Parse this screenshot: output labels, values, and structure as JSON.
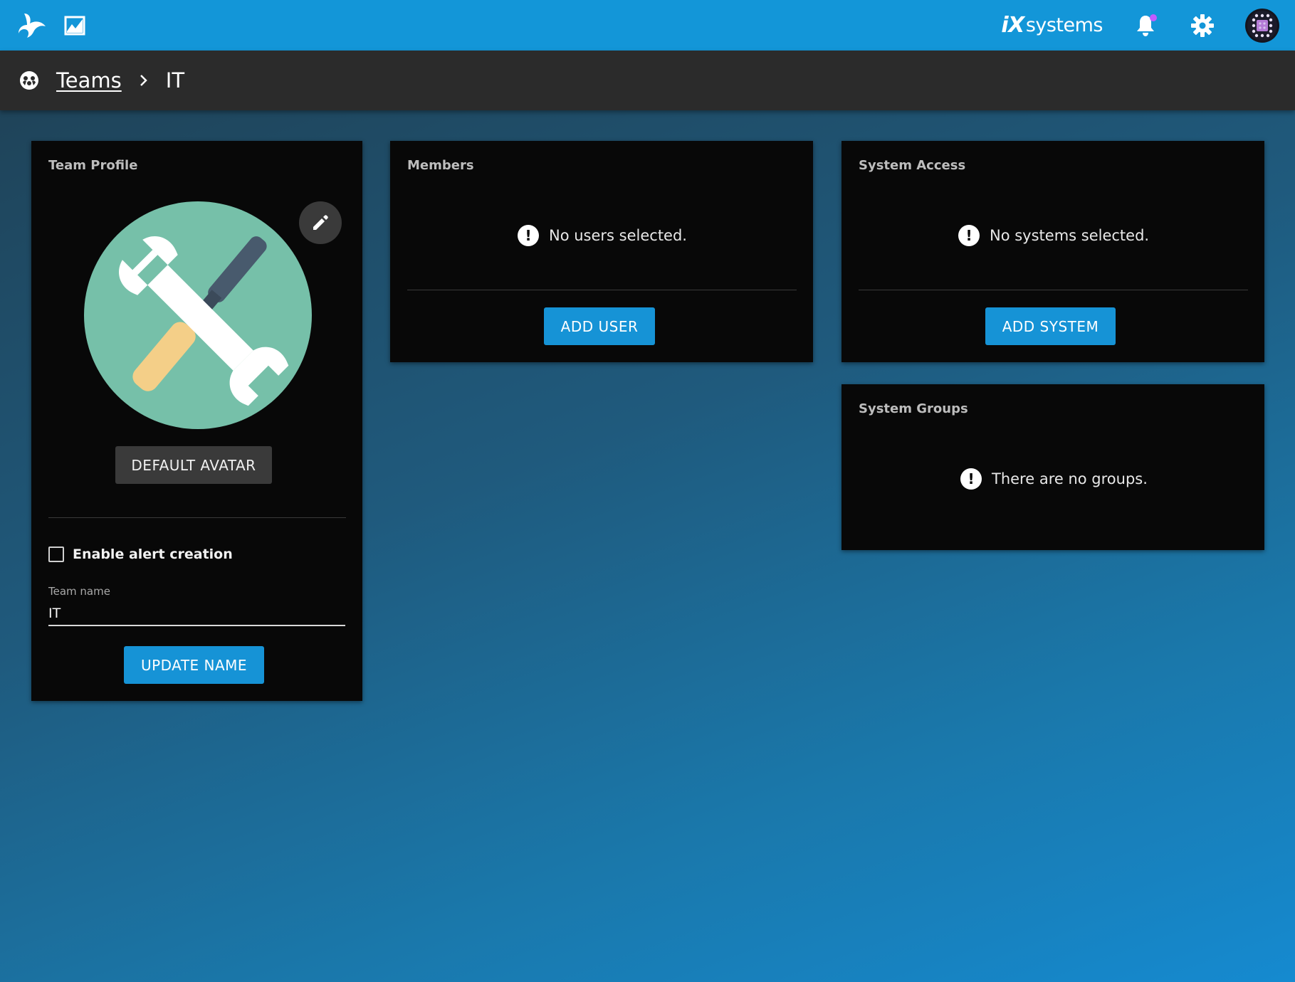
{
  "topbar": {
    "brand_ix": "iX",
    "brand_rest": "systems",
    "icons": [
      "app-logo-icon",
      "chart-icon",
      "bell-icon",
      "gear-icon",
      "user-avatar"
    ],
    "accent_color": "#1396d8",
    "notification_dot_color": "#c25cff"
  },
  "breadcrumb": {
    "icon": "teams-icon",
    "parent": "Teams",
    "current": "IT"
  },
  "team_profile": {
    "title": "Team Profile",
    "default_avatar_label": "DEFAULT AVATAR",
    "enable_alert_label": "Enable alert creation",
    "enable_alert_checked": false,
    "team_name_label": "Team name",
    "team_name_value": "IT",
    "update_name_label": "UPDATE NAME"
  },
  "members": {
    "title": "Members",
    "empty_message": "No users selected.",
    "add_label": "ADD USER"
  },
  "system_access": {
    "title": "System Access",
    "empty_message": "No systems selected.",
    "add_label": "ADD SYSTEM"
  },
  "system_groups": {
    "title": "System Groups",
    "empty_message": "There are no groups."
  }
}
